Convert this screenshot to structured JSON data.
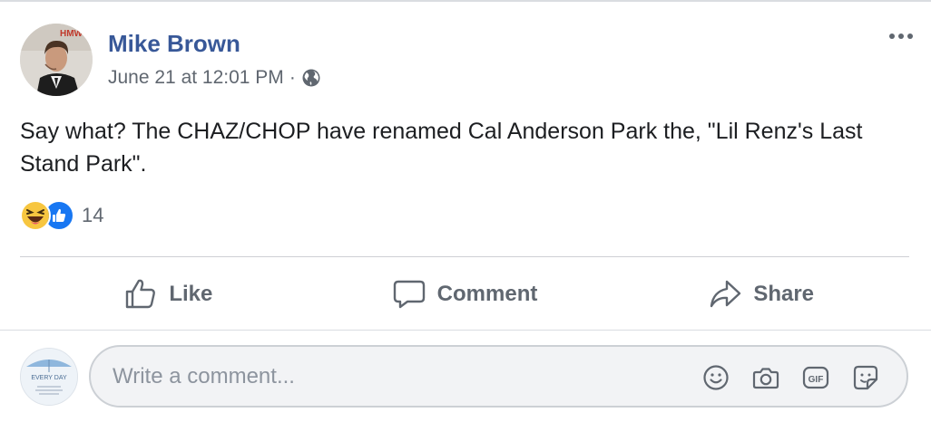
{
  "post": {
    "author": "Mike Brown",
    "timestamp": "June 21 at 12:01 PM",
    "separator": "·",
    "privacy_icon": "globe-icon",
    "text": "Say what? The CHAZ/CHOP have renamed Cal Anderson Park the, \"Lil Renz's Last Stand Park\".",
    "avatar_logo_text": "HMW"
  },
  "reactions": {
    "types": [
      "haha-icon",
      "like-icon"
    ],
    "count": "14"
  },
  "actions": {
    "like_label": "Like",
    "comment_label": "Comment",
    "share_label": "Share"
  },
  "comment": {
    "placeholder": "Write a comment...",
    "avatar_text": "EVERY DAY",
    "icons": [
      "emoji-icon",
      "camera-icon",
      "gif-icon",
      "sticker-icon"
    ],
    "gif_text": "GIF"
  },
  "colors": {
    "author": "#385898",
    "secondary_text": "#606770",
    "like_blue": "#1877f2",
    "haha_yellow": "#f7c640",
    "divider": "#ced0d4"
  }
}
